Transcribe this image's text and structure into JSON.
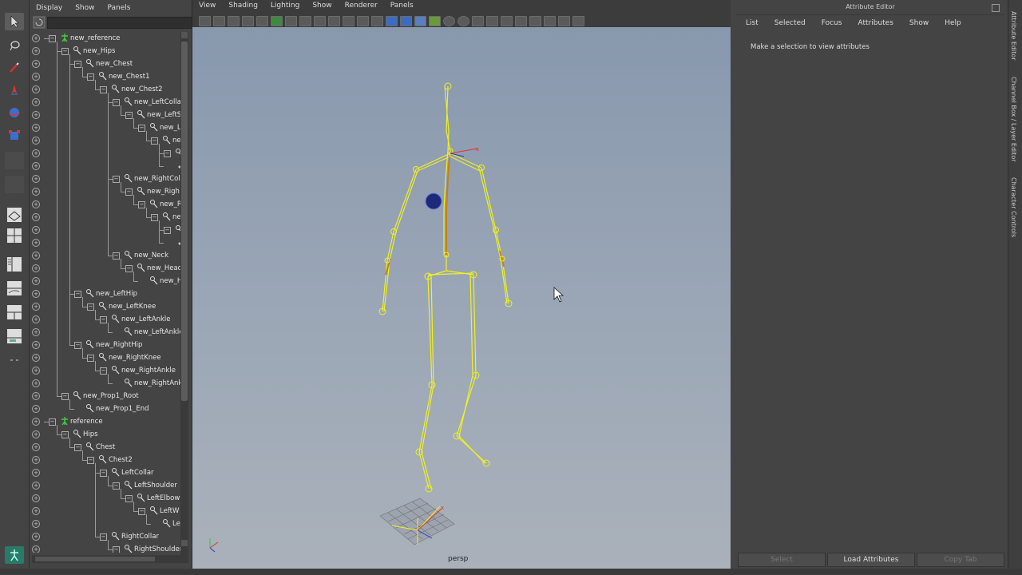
{
  "outliner": {
    "menu": [
      "Display",
      "Show",
      "Panels"
    ],
    "items": [
      {
        "label": "new_reference",
        "indent": 0,
        "kind": "ref",
        "exp": "-"
      },
      {
        "label": "new_Hips",
        "indent": 1,
        "kind": "joint",
        "exp": "-"
      },
      {
        "label": "new_Chest",
        "indent": 2,
        "kind": "joint",
        "exp": "-"
      },
      {
        "label": "new_Chest1",
        "indent": 3,
        "kind": "joint",
        "exp": "-"
      },
      {
        "label": "new_Chest2",
        "indent": 4,
        "kind": "joint",
        "exp": "-"
      },
      {
        "label": "new_LeftColla",
        "indent": 5,
        "kind": "joint",
        "exp": "-"
      },
      {
        "label": "new_LeftS",
        "indent": 6,
        "kind": "joint",
        "exp": "-"
      },
      {
        "label": "new_L",
        "indent": 7,
        "kind": "joint",
        "exp": "-"
      },
      {
        "label": "ne",
        "indent": 8,
        "kind": "joint",
        "exp": "-"
      },
      {
        "label": "",
        "indent": 9,
        "kind": "joint",
        "exp": "-"
      },
      {
        "label": "",
        "indent": 9,
        "kind": "end",
        "exp": ""
      },
      {
        "label": "new_RightColl",
        "indent": 5,
        "kind": "joint",
        "exp": "-"
      },
      {
        "label": "new_Righ",
        "indent": 6,
        "kind": "joint",
        "exp": "-"
      },
      {
        "label": "new_R",
        "indent": 7,
        "kind": "joint",
        "exp": "-"
      },
      {
        "label": "ne",
        "indent": 8,
        "kind": "joint",
        "exp": "-"
      },
      {
        "label": "",
        "indent": 9,
        "kind": "joint",
        "exp": "-"
      },
      {
        "label": "",
        "indent": 9,
        "kind": "end",
        "exp": ""
      },
      {
        "label": "new_Neck",
        "indent": 5,
        "kind": "joint",
        "exp": "-"
      },
      {
        "label": "new_Head",
        "indent": 6,
        "kind": "joint",
        "exp": "-"
      },
      {
        "label": "new_H",
        "indent": 7,
        "kind": "joint",
        "exp": ""
      },
      {
        "label": "new_LeftHip",
        "indent": 2,
        "kind": "joint",
        "exp": "-"
      },
      {
        "label": "new_LeftKnee",
        "indent": 3,
        "kind": "joint",
        "exp": "-"
      },
      {
        "label": "new_LeftAnkle",
        "indent": 4,
        "kind": "joint",
        "exp": "-"
      },
      {
        "label": "new_LeftAnkle",
        "indent": 5,
        "kind": "joint",
        "exp": ""
      },
      {
        "label": "new_RightHip",
        "indent": 2,
        "kind": "joint",
        "exp": "-"
      },
      {
        "label": "new_RightKnee",
        "indent": 3,
        "kind": "joint",
        "exp": "-"
      },
      {
        "label": "new_RightAnkle",
        "indent": 4,
        "kind": "joint",
        "exp": "-"
      },
      {
        "label": "new_RightAnk",
        "indent": 5,
        "kind": "joint",
        "exp": ""
      },
      {
        "label": "new_Prop1_Root",
        "indent": 1,
        "kind": "joint",
        "exp": "-"
      },
      {
        "label": "new_Prop1_End",
        "indent": 2,
        "kind": "joint",
        "exp": ""
      },
      {
        "label": "reference",
        "indent": 0,
        "kind": "ref",
        "exp": "-"
      },
      {
        "label": "Hips",
        "indent": 1,
        "kind": "joint",
        "exp": "-"
      },
      {
        "label": "Chest",
        "indent": 2,
        "kind": "joint",
        "exp": "-"
      },
      {
        "label": "Chest2",
        "indent": 3,
        "kind": "joint",
        "exp": "-"
      },
      {
        "label": "LeftCollar",
        "indent": 4,
        "kind": "joint",
        "exp": "-"
      },
      {
        "label": "LeftShoulder",
        "indent": 5,
        "kind": "joint",
        "exp": "-"
      },
      {
        "label": "LeftElbow",
        "indent": 6,
        "kind": "joint",
        "exp": "-"
      },
      {
        "label": "LeftW",
        "indent": 7,
        "kind": "joint",
        "exp": "-"
      },
      {
        "label": "Le",
        "indent": 8,
        "kind": "joint",
        "exp": ""
      },
      {
        "label": "RightCollar",
        "indent": 4,
        "kind": "joint",
        "exp": "-"
      },
      {
        "label": "RightShoulder",
        "indent": 5,
        "kind": "joint",
        "exp": "-"
      }
    ]
  },
  "viewport": {
    "menu": [
      "View",
      "Shading",
      "Lighting",
      "Show",
      "Renderer",
      "Panels"
    ],
    "camera_label": "persp"
  },
  "attribute_editor": {
    "title": "Attribute Editor",
    "menu": [
      "List",
      "Selected",
      "Focus",
      "Attributes",
      "Show",
      "Help"
    ],
    "message": "Make a selection to view attributes",
    "buttons": {
      "select": "Select",
      "load": "Load Attributes",
      "copy": "Copy Tab"
    }
  },
  "side_tabs": [
    "Attribute Editor",
    "Channel Box / Layer Editor",
    "Character Controls"
  ],
  "colors": {
    "skeleton": "#f0f020",
    "bone_inner": "#c08020",
    "selection_ball": "#1c2a7a"
  }
}
